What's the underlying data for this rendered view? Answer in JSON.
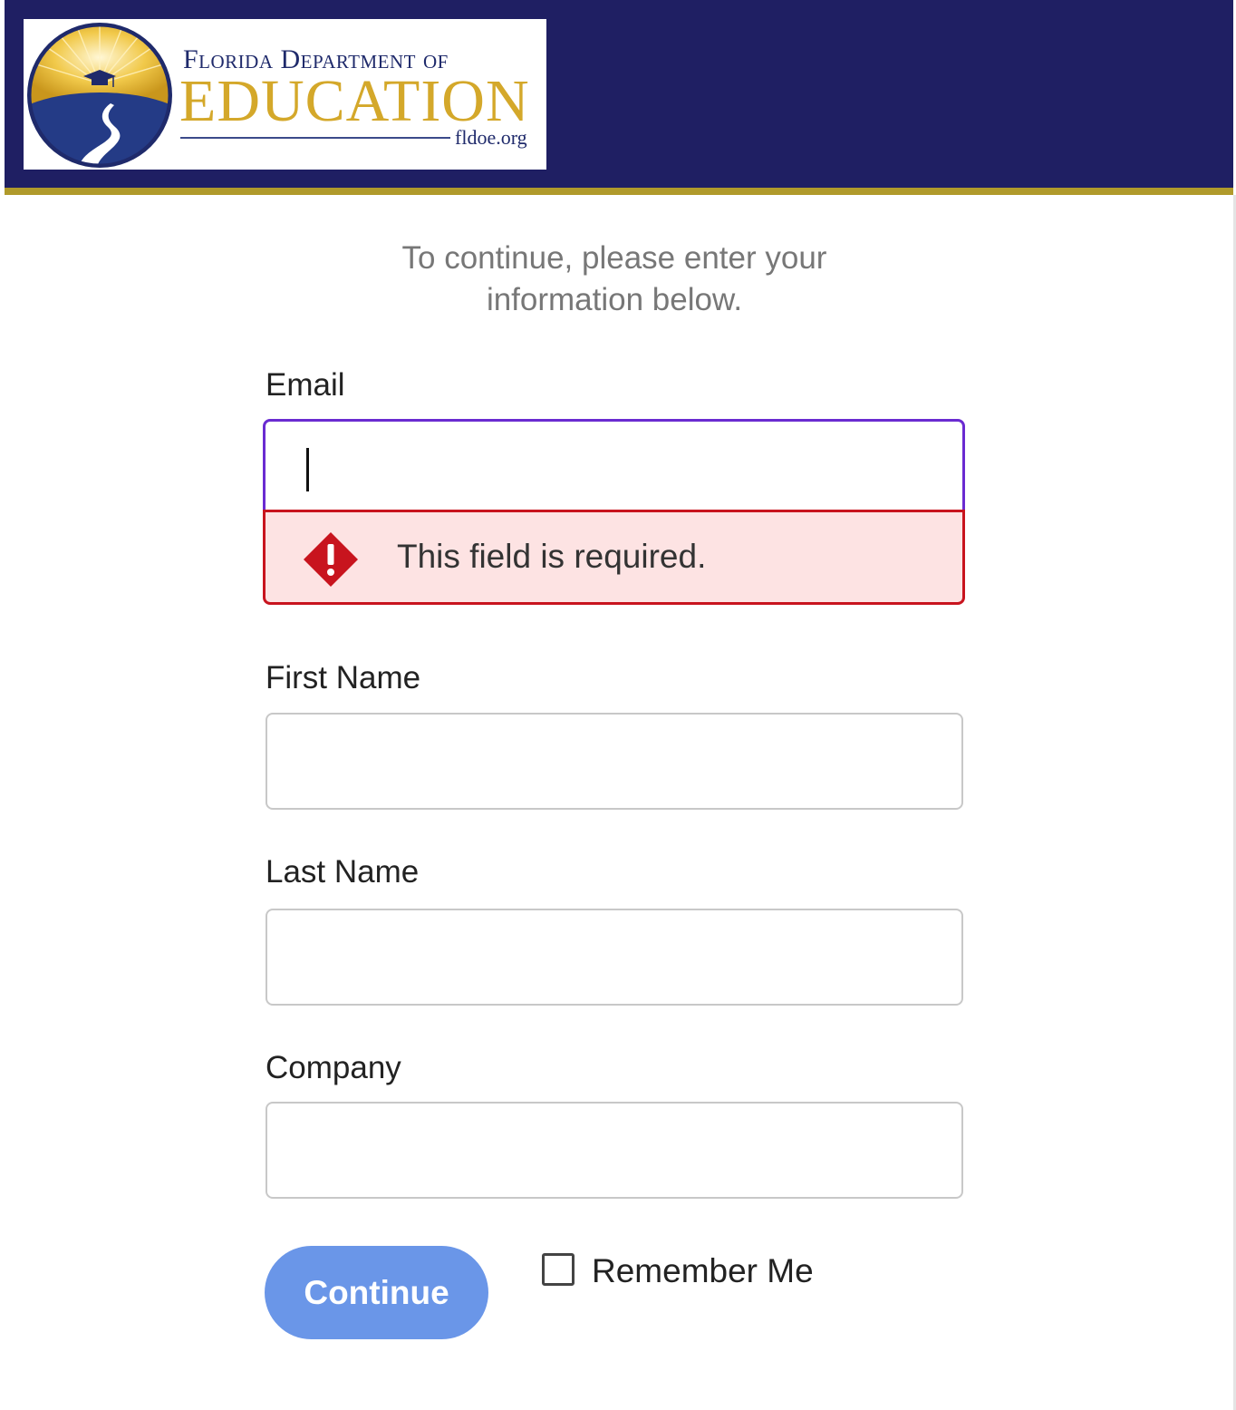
{
  "header": {
    "logo": {
      "line1": "Florida Department of",
      "line2": "EDUCATION",
      "url": "fldoe.org"
    }
  },
  "intro": {
    "text": "To continue, please enter your information below."
  },
  "form": {
    "email": {
      "label": "Email",
      "value": "",
      "error": "This field is required."
    },
    "first_name": {
      "label": "First Name",
      "value": ""
    },
    "last_name": {
      "label": "Last Name",
      "value": ""
    },
    "company": {
      "label": "Company",
      "value": ""
    },
    "continue_label": "Continue",
    "remember_label": "Remember Me",
    "remember_checked": false
  },
  "colors": {
    "header_bg": "#1f1f63",
    "header_stripe": "#b09a2b",
    "focus_border": "#6a2bd1",
    "error_border": "#c8141e",
    "error_bg": "#fde3e3",
    "button_bg": "#6a96e8"
  },
  "icons": {
    "error": "alert-diamond-icon",
    "checkbox": "checkbox-unchecked-icon"
  }
}
